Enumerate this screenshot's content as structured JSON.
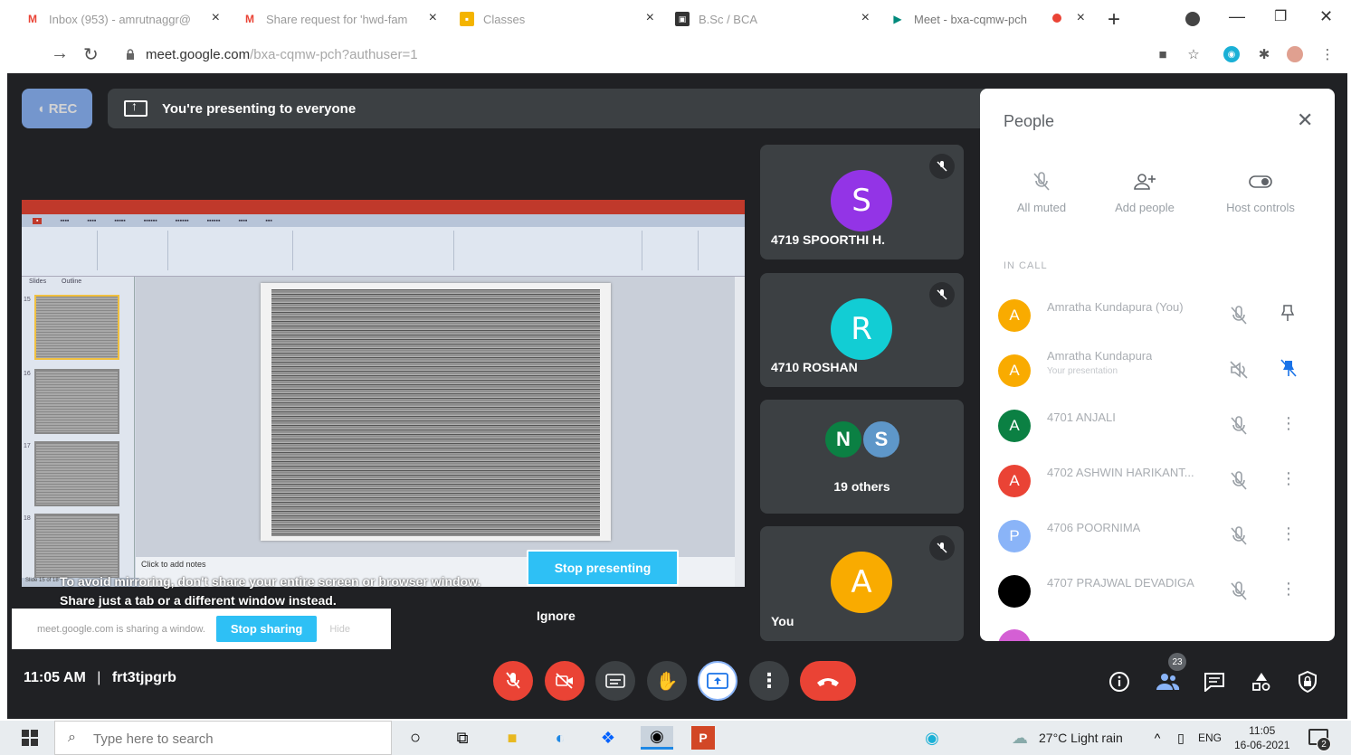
{
  "browser": {
    "tabs": [
      {
        "title": "Inbox (953) - amrutnaggr@",
        "favicon": "gmail-icon",
        "color": "#ea4335"
      },
      {
        "title": "Share request for 'hwd-fam",
        "favicon": "gmail-icon",
        "color": "#ea4335"
      },
      {
        "title": "Classes",
        "favicon": "classroom-icon",
        "color": "#f4b400"
      },
      {
        "title": "B.Sc / BCA",
        "favicon": "class-icon",
        "color": "#333333"
      },
      {
        "title": "Meet - bxa-cqmw-pch",
        "favicon": "meet-icon",
        "color": "#00897b"
      }
    ],
    "url_host": "meet.google.com",
    "url_path": "/bxa-cqmw-pch?authuser=1"
  },
  "meet": {
    "rec_label": "REC",
    "present_banner": "You're presenting to everyone",
    "shared_app": {
      "notes_placeholder": "Click to add notes",
      "slide_numbers": [
        "15",
        "16",
        "17",
        "18"
      ],
      "status": "Slide 15 of 18",
      "pane_tabs": [
        "Slides",
        "Outline"
      ]
    },
    "mirror_warning": "To avoid mirroring, don't share your entire screen or browser window. Share just a tab or a different window instead.",
    "stop_presenting": "Stop presenting",
    "ignore": "Ignore",
    "sharing_bar": {
      "text": "meet.google.com is sharing a window.",
      "stop": "Stop sharing",
      "hide": "Hide"
    },
    "tiles": [
      {
        "name": "4719 SPOORTHI H.",
        "initial": "S",
        "color": "#9334e6",
        "muted": true
      },
      {
        "name": "4710 ROSHAN",
        "initial": "R",
        "color": "#12cdd4",
        "muted": true
      },
      {
        "name": "19 others",
        "initials": [
          "N",
          "S"
        ],
        "colors": [
          "#0b8043",
          "#5e97c9"
        ]
      },
      {
        "name": "You",
        "initial": "A",
        "color": "#f9ab00",
        "muted": true
      }
    ],
    "meeting_time": "11:05 AM",
    "meeting_code": "frt3tjpgrb",
    "people_count": "23"
  },
  "people_panel": {
    "title": "People",
    "actions": [
      "All muted",
      "Add people",
      "Host controls"
    ],
    "in_call_label": "IN CALL",
    "participants": [
      {
        "name": "Amratha Kundapura (You)",
        "sub": "",
        "initial": "A",
        "color": "#f9ab00"
      },
      {
        "name": "Amratha Kundapura",
        "sub": "Your presentation",
        "initial": "A",
        "color": "#f9ab00"
      },
      {
        "name": "4701 ANJALI",
        "sub": "",
        "initial": "A",
        "color": "#0b8043"
      },
      {
        "name": "4702 ASHWIN HARIKANT...",
        "sub": "",
        "initial": "A",
        "color": "#ea4335"
      },
      {
        "name": "4706 POORNIMA",
        "sub": "",
        "initial": "P",
        "color": "#8ab4f8"
      },
      {
        "name": "4707 PRAJWAL DEVADIGA",
        "sub": "",
        "initial": "",
        "color": "#000000"
      }
    ]
  },
  "taskbar": {
    "search_placeholder": "Type here to search",
    "weather": "27°C  Light rain",
    "lang": "ENG",
    "time": "11:05",
    "date": "16-06-2021",
    "notifications": "2"
  }
}
